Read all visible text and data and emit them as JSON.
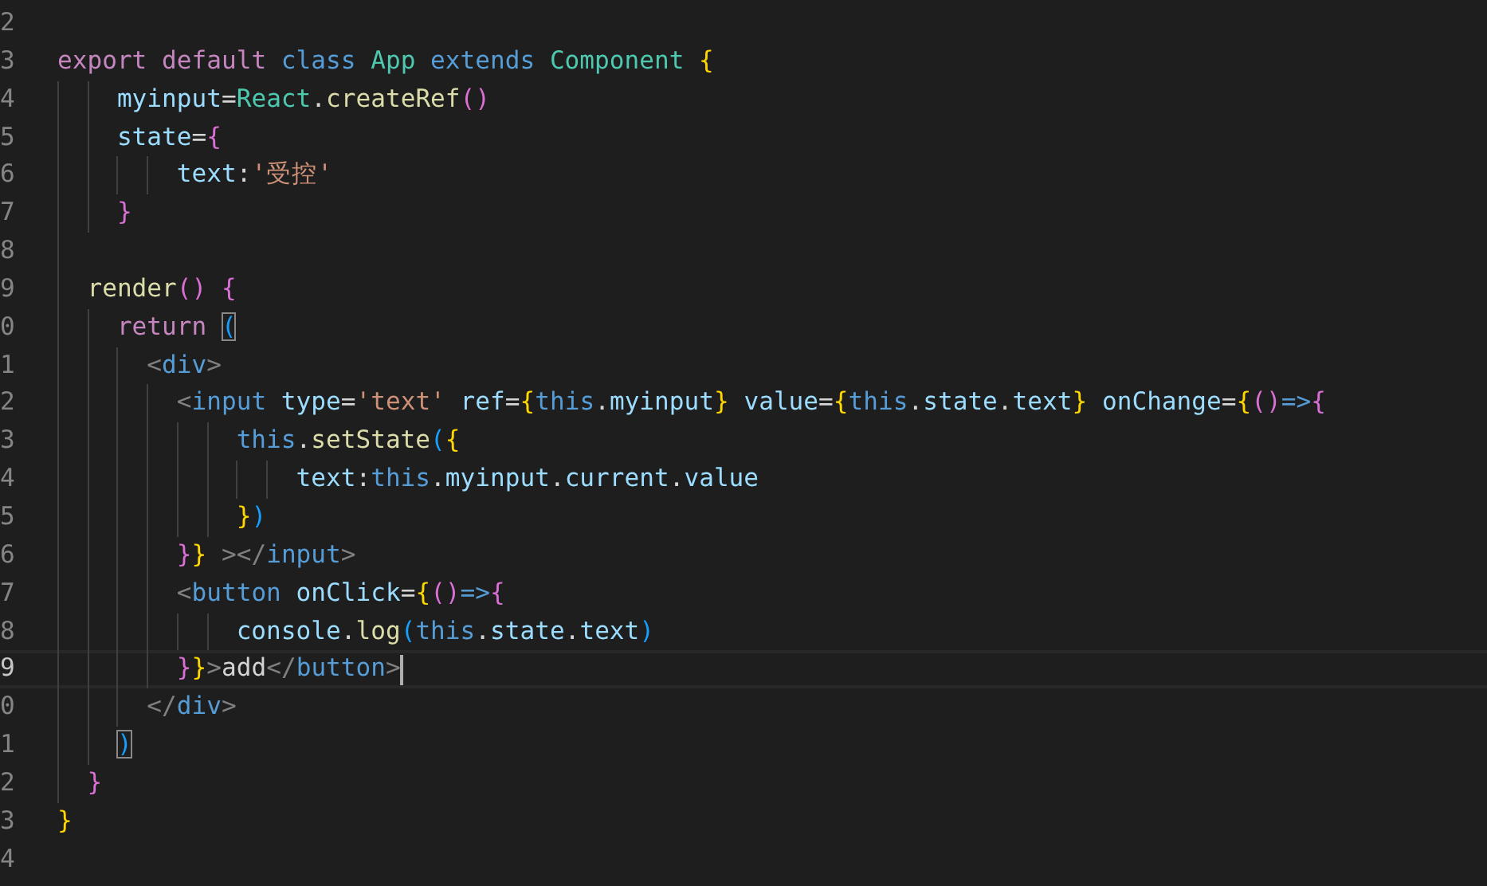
{
  "editor": {
    "lines": [
      {
        "number": "2",
        "current": false
      },
      {
        "number": "3",
        "current": false,
        "tokens": [
          {
            "kind": "kw",
            "text": "export "
          },
          {
            "kind": "kw",
            "text": "default "
          },
          {
            "kind": "st",
            "text": "class "
          },
          {
            "kind": "ty",
            "text": "App "
          },
          {
            "kind": "st",
            "text": "extends "
          },
          {
            "kind": "ty",
            "text": "Component "
          },
          {
            "kind": "b1",
            "text": "{"
          }
        ]
      },
      {
        "number": "4",
        "current": false,
        "tokens": [
          {
            "kind": "var",
            "text": "    myinput"
          },
          {
            "kind": "p",
            "text": "="
          },
          {
            "kind": "ty",
            "text": "React"
          },
          {
            "kind": "p",
            "text": "."
          },
          {
            "kind": "fn",
            "text": "createRef"
          },
          {
            "kind": "b2",
            "text": "()"
          }
        ]
      },
      {
        "number": "5",
        "current": false,
        "tokens": [
          {
            "kind": "var",
            "text": "    state"
          },
          {
            "kind": "p",
            "text": "="
          },
          {
            "kind": "b2",
            "text": "{"
          }
        ]
      },
      {
        "number": "6",
        "current": false,
        "tokens": [
          {
            "kind": "var",
            "text": "        text"
          },
          {
            "kind": "p",
            "text": ":"
          },
          {
            "kind": "str",
            "text": "'受控'"
          }
        ]
      },
      {
        "number": "7",
        "current": false,
        "tokens": [
          {
            "kind": "b2",
            "text": "    }"
          }
        ]
      },
      {
        "number": "8",
        "current": false
      },
      {
        "number": "9",
        "current": false,
        "tokens": [
          {
            "kind": "fn",
            "text": "  render"
          },
          {
            "kind": "b2",
            "text": "() {"
          }
        ]
      },
      {
        "number": "0",
        "current": false,
        "tokens": [
          {
            "kind": "kw",
            "text": "    return "
          },
          {
            "kind": "match",
            "text": "("
          }
        ]
      },
      {
        "number": "1",
        "current": false,
        "tokens": [
          {
            "kind": "tag",
            "text": "      <"
          },
          {
            "kind": "st",
            "text": "div"
          },
          {
            "kind": "tag",
            "text": ">"
          }
        ]
      },
      {
        "number": "2",
        "current": false,
        "tokens": [
          {
            "kind": "tag",
            "text": "        <"
          },
          {
            "kind": "st",
            "text": "input "
          },
          {
            "kind": "var",
            "text": "type"
          },
          {
            "kind": "p",
            "text": "="
          },
          {
            "kind": "str",
            "text": "'text' "
          },
          {
            "kind": "var",
            "text": "ref"
          },
          {
            "kind": "p",
            "text": "="
          },
          {
            "kind": "b1",
            "text": "{"
          },
          {
            "kind": "st",
            "text": "this"
          },
          {
            "kind": "p",
            "text": "."
          },
          {
            "kind": "var",
            "text": "myinput"
          },
          {
            "kind": "b1",
            "text": "} "
          },
          {
            "kind": "var",
            "text": "value"
          },
          {
            "kind": "p",
            "text": "="
          },
          {
            "kind": "b1",
            "text": "{"
          },
          {
            "kind": "st",
            "text": "this"
          },
          {
            "kind": "p",
            "text": "."
          },
          {
            "kind": "var",
            "text": "state"
          },
          {
            "kind": "p",
            "text": "."
          },
          {
            "kind": "var",
            "text": "text"
          },
          {
            "kind": "b1",
            "text": "} "
          },
          {
            "kind": "var",
            "text": "onChange"
          },
          {
            "kind": "p",
            "text": "="
          },
          {
            "kind": "b1",
            "text": "{"
          },
          {
            "kind": "b2",
            "text": "()"
          },
          {
            "kind": "st",
            "text": "=>"
          },
          {
            "kind": "b2",
            "text": "{"
          }
        ]
      },
      {
        "number": "3",
        "current": false,
        "tokens": [
          {
            "kind": "st",
            "text": "            this"
          },
          {
            "kind": "p",
            "text": "."
          },
          {
            "kind": "fn",
            "text": "setState"
          },
          {
            "kind": "b3",
            "text": "("
          },
          {
            "kind": "b1",
            "text": "{"
          }
        ]
      },
      {
        "number": "4",
        "current": false,
        "tokens": [
          {
            "kind": "var",
            "text": "                text"
          },
          {
            "kind": "p",
            "text": ":"
          },
          {
            "kind": "st",
            "text": "this"
          },
          {
            "kind": "p",
            "text": "."
          },
          {
            "kind": "var",
            "text": "myinput"
          },
          {
            "kind": "p",
            "text": "."
          },
          {
            "kind": "var",
            "text": "current"
          },
          {
            "kind": "p",
            "text": "."
          },
          {
            "kind": "var",
            "text": "value"
          }
        ]
      },
      {
        "number": "5",
        "current": false,
        "tokens": [
          {
            "kind": "b1",
            "text": "            }"
          },
          {
            "kind": "b3",
            "text": ")"
          }
        ]
      },
      {
        "number": "6",
        "current": false,
        "tokens": [
          {
            "kind": "b2",
            "text": "        }"
          },
          {
            "kind": "b1",
            "text": "} "
          },
          {
            "kind": "tag",
            "text": "></"
          },
          {
            "kind": "st",
            "text": "input"
          },
          {
            "kind": "tag",
            "text": ">"
          }
        ]
      },
      {
        "number": "7",
        "current": false,
        "tokens": [
          {
            "kind": "tag",
            "text": "        <"
          },
          {
            "kind": "st",
            "text": "button "
          },
          {
            "kind": "var",
            "text": "onClick"
          },
          {
            "kind": "p",
            "text": "="
          },
          {
            "kind": "b1",
            "text": "{"
          },
          {
            "kind": "b2",
            "text": "()"
          },
          {
            "kind": "st",
            "text": "=>"
          },
          {
            "kind": "b2",
            "text": "{"
          }
        ]
      },
      {
        "number": "8",
        "current": false,
        "tokens": [
          {
            "kind": "var",
            "text": "            console"
          },
          {
            "kind": "p",
            "text": "."
          },
          {
            "kind": "fn",
            "text": "log"
          },
          {
            "kind": "b3",
            "text": "("
          },
          {
            "kind": "st",
            "text": "this"
          },
          {
            "kind": "p",
            "text": "."
          },
          {
            "kind": "var",
            "text": "state"
          },
          {
            "kind": "p",
            "text": "."
          },
          {
            "kind": "var",
            "text": "text"
          },
          {
            "kind": "b3",
            "text": ")"
          }
        ]
      },
      {
        "number": "9",
        "current": true,
        "tokens": [
          {
            "kind": "b2",
            "text": "        }"
          },
          {
            "kind": "b1",
            "text": "}"
          },
          {
            "kind": "tag",
            "text": ">"
          },
          {
            "kind": "p",
            "text": "add"
          },
          {
            "kind": "tag",
            "text": "</"
          },
          {
            "kind": "st",
            "text": "button"
          },
          {
            "kind": "tag",
            "text": ">"
          }
        ]
      },
      {
        "number": "0",
        "current": false,
        "tokens": [
          {
            "kind": "tag",
            "text": "      </"
          },
          {
            "kind": "st",
            "text": "div"
          },
          {
            "kind": "tag",
            "text": ">"
          }
        ]
      },
      {
        "number": "1",
        "current": false,
        "tokens": [
          {
            "kind": "match",
            "text": "    )"
          }
        ]
      },
      {
        "number": "2",
        "current": false,
        "tokens": [
          {
            "kind": "b2",
            "text": "  }"
          }
        ]
      },
      {
        "number": "3",
        "current": false,
        "tokens": [
          {
            "kind": "b1",
            "text": "}"
          }
        ]
      },
      {
        "number": "4",
        "current": false
      }
    ]
  }
}
